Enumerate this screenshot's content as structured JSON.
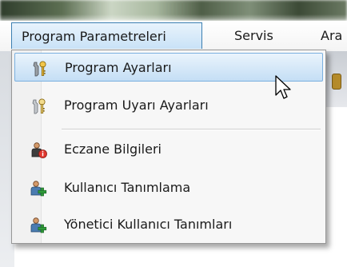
{
  "menubar": {
    "items": [
      {
        "label": "Program Parametreleri"
      },
      {
        "label": "Servis"
      },
      {
        "label": "Ara"
      }
    ]
  },
  "dropdown": {
    "items": [
      {
        "label": "Program Ayarları",
        "icon": "tools-icon",
        "highlighted": true
      },
      {
        "label": "Program Uyarı Ayarları",
        "icon": "tools-icon"
      },
      {
        "label": "Eczane Bilgileri",
        "icon": "user-info-icon"
      },
      {
        "label": "Kullanıcı Tanımlama",
        "icon": "user-add-icon"
      },
      {
        "label": "Yönetici Kullanıcı Tanımları",
        "icon": "user-add-icon"
      }
    ]
  },
  "colors": {
    "highlight": "#c4def5",
    "highlight_border": "#7bb0df",
    "menubar_active_border": "#3c7fb1"
  }
}
